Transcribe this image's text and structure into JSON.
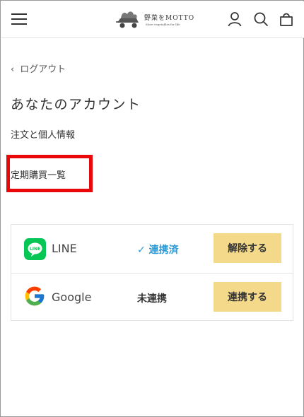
{
  "header": {
    "logo_text": "野菜をMOTTO",
    "logo_subtext": "More vegetables for life"
  },
  "nav": {
    "back_label": "ログアウト"
  },
  "page": {
    "title": "あなたのアカウント",
    "links": [
      {
        "label": "注文と個人情報"
      },
      {
        "label": "定期購買一覧"
      }
    ]
  },
  "accounts": [
    {
      "name": "LINE",
      "status_text": "連携済",
      "button_label": "解除する",
      "linked": true
    },
    {
      "name": "Google",
      "status_text": "未連携",
      "button_label": "連携する",
      "linked": false
    }
  ],
  "colors": {
    "button_bg": "#f5d98b",
    "linked_status": "#2a9bd6",
    "highlight": "#e8080c",
    "line_brand": "#06c755"
  }
}
